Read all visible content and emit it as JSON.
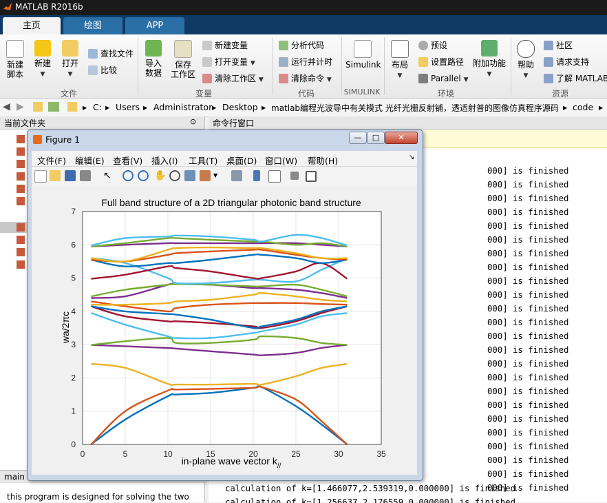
{
  "app": {
    "title": "MATLAB R2016b"
  },
  "tabs": [
    {
      "label": "主页",
      "active": true
    },
    {
      "label": "绘图",
      "active": false
    },
    {
      "label": "APP",
      "active": false
    }
  ],
  "ribbon": {
    "file": {
      "new_script": "新建\n脚本",
      "new": "新建",
      "open": "打开",
      "find_files": "查找文件",
      "compare": "比较",
      "group": "文件"
    },
    "variable": {
      "import": "导入\n数据",
      "save": "保存\n工作区",
      "new_var": "新建变量",
      "open_var": "打开变量",
      "clear_ws": "清除工作区",
      "group": "变量"
    },
    "code": {
      "analyze": "分析代码",
      "run_time": "运行并计时",
      "clear_cmd": "清除命令",
      "group": "代码"
    },
    "simulink": {
      "label": "Simulink",
      "group": "SIMULINK"
    },
    "env": {
      "layout": "布局",
      "prefs": "预设",
      "set_path": "设置路径",
      "parallel": "Parallel",
      "addons": "附加功能",
      "group": "环境"
    },
    "resources": {
      "help": "帮助",
      "community": "社区",
      "support": "请求支持",
      "learn": "了解 MATLAB",
      "group": "资源"
    }
  },
  "breadcrumb": [
    "C:",
    "Users",
    "Administrator",
    "Desktop",
    "matlab编程光波导中有关模式 光纤光栅反射铺，透适射普的图像仿真程序源码",
    "code"
  ],
  "left_panel": {
    "title": "当前文件夹",
    "bottom_tab": "main",
    "desc": "this program is designed for solving the two"
  },
  "cmd_panel": {
    "title": "命令行窗口",
    "lines": [
      "000] is finished",
      "000] is finished",
      "000] is finished",
      "000] is finished",
      "000] is finished",
      "000] is finished",
      "000] is finished",
      "000] is finished",
      "000] is finished",
      "000] is finished",
      "000] is finished",
      "000] is finished",
      "000] is finished",
      "000] is finished",
      "000] is finished",
      "000] is finished",
      "000] is finished",
      "000] is finished",
      "000] is finished",
      "000] is finished",
      "000] is finished",
      "000] is finished",
      "000] is finished",
      "000] is finished"
    ],
    "last_line": "calculation of k=[1.466077,2.539319,0.000000] is finished",
    "cut_line": "calculation of k=[1.256637,2.176559,0.000000] is finished"
  },
  "figure": {
    "title": "Figure 1",
    "menu": [
      "文件(F)",
      "编辑(E)",
      "查看(V)",
      "插入(I)",
      "工具(T)",
      "桌面(D)",
      "窗口(W)",
      "帮助(H)"
    ]
  },
  "chart_data": {
    "type": "line",
    "title": "Full band structure of a 2D triangular photonic band structure",
    "xlabel": "in-plane wave vector k",
    "xlabel_sub": "//",
    "ylabel": "wa/2πc",
    "xlim": [
      0,
      35
    ],
    "ylim": [
      0,
      7
    ],
    "xticks": [
      0,
      5,
      10,
      15,
      20,
      25,
      30,
      35
    ],
    "yticks": [
      0,
      1,
      2,
      3,
      4,
      5,
      6,
      7
    ],
    "grid": true,
    "series": [
      {
        "color": "#0072bd",
        "x": [
          1,
          5,
          10,
          11,
          15,
          20,
          21,
          25,
          28,
          31
        ],
        "y": [
          0,
          0.75,
          1.45,
          1.5,
          1.55,
          1.7,
          1.72,
          1.15,
          0.6,
          0
        ]
      },
      {
        "color": "#d95319",
        "x": [
          1,
          5,
          10,
          11,
          15,
          20,
          21,
          25,
          28,
          31
        ],
        "y": [
          0,
          1.0,
          1.62,
          1.65,
          1.67,
          1.7,
          1.72,
          1.35,
          0.7,
          0
        ]
      },
      {
        "color": "#edb120",
        "x": [
          1,
          5,
          10,
          11,
          15,
          20,
          21,
          25,
          28,
          31
        ],
        "y": [
          2.42,
          2.3,
          1.82,
          1.8,
          1.8,
          1.82,
          1.8,
          2.05,
          2.3,
          2.42
        ]
      },
      {
        "color": "#7e2f8e",
        "x": [
          1,
          5,
          10,
          11,
          15,
          20,
          21,
          25,
          28,
          31
        ],
        "y": [
          2.99,
          2.95,
          2.9,
          2.88,
          2.8,
          2.7,
          2.68,
          2.75,
          2.9,
          2.99
        ]
      },
      {
        "color": "#77ac30",
        "x": [
          1,
          5,
          10,
          11,
          15,
          20,
          21,
          25,
          28,
          31
        ],
        "y": [
          2.99,
          3.1,
          3.2,
          3.05,
          3.05,
          3.15,
          3.25,
          3.2,
          3.05,
          2.99
        ]
      },
      {
        "color": "#4dbeee",
        "x": [
          1,
          5,
          10,
          11,
          15,
          20,
          21,
          25,
          28,
          31
        ],
        "y": [
          3.95,
          3.6,
          3.25,
          3.2,
          3.2,
          3.35,
          3.4,
          3.6,
          3.85,
          3.95
        ]
      },
      {
        "color": "#a2142f",
        "x": [
          1,
          5,
          10,
          11,
          15,
          20,
          21,
          25,
          28,
          31
        ],
        "y": [
          4.15,
          3.85,
          3.7,
          3.7,
          3.65,
          3.55,
          3.5,
          3.7,
          3.95,
          4.15
        ]
      },
      {
        "color": "#0072bd",
        "x": [
          1,
          5,
          10,
          11,
          15,
          20,
          21,
          25,
          28,
          31
        ],
        "y": [
          4.15,
          4.0,
          3.92,
          3.9,
          3.75,
          3.5,
          3.55,
          3.75,
          4.0,
          4.15
        ]
      },
      {
        "color": "#d95319",
        "x": [
          1,
          5,
          10,
          11,
          15,
          20,
          21,
          25,
          28,
          31
        ],
        "y": [
          4.3,
          4.15,
          4.0,
          4.1,
          4.2,
          4.25,
          4.25,
          4.25,
          4.22,
          4.2
        ]
      },
      {
        "color": "#edb120",
        "x": [
          1,
          5,
          10,
          11,
          15,
          20,
          21,
          25,
          28,
          31
        ],
        "y": [
          4.2,
          4.2,
          4.25,
          4.3,
          4.35,
          4.5,
          4.55,
          4.45,
          4.35,
          4.3
        ]
      },
      {
        "color": "#7e2f8e",
        "x": [
          1,
          5,
          10,
          11,
          15,
          20,
          21,
          25,
          28,
          31
        ],
        "y": [
          4.4,
          4.45,
          4.8,
          4.82,
          4.8,
          4.7,
          4.7,
          4.65,
          4.55,
          4.4
        ]
      },
      {
        "color": "#77ac30",
        "x": [
          1,
          5,
          10,
          11,
          15,
          20,
          21,
          25,
          28,
          31
        ],
        "y": [
          4.45,
          4.65,
          4.8,
          4.82,
          4.8,
          4.75,
          4.75,
          4.8,
          4.65,
          4.45
        ]
      },
      {
        "color": "#4dbeee",
        "x": [
          1,
          5,
          10,
          11,
          15,
          20,
          21,
          25,
          28,
          31
        ],
        "y": [
          5.6,
          5.45,
          5.0,
          4.85,
          4.85,
          4.95,
          4.95,
          4.9,
          5.25,
          5.6
        ]
      },
      {
        "color": "#a2142f",
        "x": [
          1,
          5,
          10,
          11,
          15,
          20,
          21,
          25,
          28,
          31
        ],
        "y": [
          4.98,
          5.1,
          5.35,
          5.3,
          5.2,
          5.0,
          5.0,
          5.2,
          5.45,
          4.98
        ]
      },
      {
        "color": "#0072bd",
        "x": [
          1,
          5,
          10,
          11,
          15,
          20,
          21,
          25,
          28,
          31
        ],
        "y": [
          5.55,
          5.35,
          5.45,
          5.45,
          5.55,
          5.7,
          5.7,
          5.6,
          5.45,
          5.55
        ]
      },
      {
        "color": "#d95319",
        "x": [
          1,
          5,
          10,
          11,
          15,
          20,
          21,
          25,
          28,
          31
        ],
        "y": [
          5.55,
          5.5,
          5.7,
          5.75,
          5.8,
          5.85,
          5.85,
          5.7,
          5.6,
          5.55
        ]
      },
      {
        "color": "#edb120",
        "x": [
          1,
          5,
          10,
          11,
          15,
          20,
          21,
          25,
          28,
          31
        ],
        "y": [
          5.6,
          5.5,
          5.85,
          5.9,
          5.92,
          5.9,
          5.9,
          5.75,
          5.6,
          5.6
        ]
      },
      {
        "color": "#7e2f8e",
        "x": [
          1,
          5,
          10,
          11,
          15,
          20,
          21,
          25,
          28,
          31
        ],
        "y": [
          5.95,
          6.0,
          6.05,
          6.05,
          6.05,
          6.05,
          6.05,
          6.05,
          6.0,
          5.95
        ]
      },
      {
        "color": "#77ac30",
        "x": [
          1,
          5,
          10,
          11,
          15,
          20,
          21,
          25,
          28,
          31
        ],
        "y": [
          5.95,
          6.05,
          6.2,
          6.2,
          6.15,
          6.1,
          6.1,
          6.0,
          6.05,
          5.95
        ]
      },
      {
        "color": "#4dbeee",
        "x": [
          1,
          5,
          10,
          11,
          15,
          20,
          21,
          25,
          28,
          31
        ],
        "y": [
          5.98,
          6.2,
          6.25,
          6.28,
          6.25,
          6.15,
          6.1,
          6.3,
          6.2,
          5.98
        ]
      }
    ]
  }
}
